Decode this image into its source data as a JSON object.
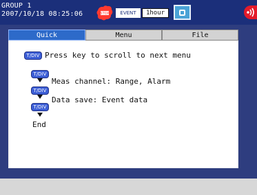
{
  "header": {
    "group_title": "GROUP 1",
    "datetime": "2007/10/18 08:25:06",
    "event_label": "EVENT",
    "interval": "1hour",
    "icons": [
      "stop-icon",
      "display-icon",
      "alarm-icon"
    ]
  },
  "tabs": [
    {
      "label": "Quick",
      "active": true
    },
    {
      "label": "Menu",
      "active": false
    },
    {
      "label": "File",
      "active": false
    }
  ],
  "panel": {
    "key_label": "T/DIV",
    "instruction": "Press key to scroll to next menu",
    "items": [
      "Meas channel: Range, Alarm",
      "Data save: Event data"
    ],
    "end_label": "End"
  },
  "colors": {
    "header_bg": "#1b2f7a",
    "screen_bg": "#2e3d7f",
    "active_tab": "#2d6ac9",
    "key_blue": "#3d5fd6",
    "alarm_red": "#e31b2a"
  }
}
